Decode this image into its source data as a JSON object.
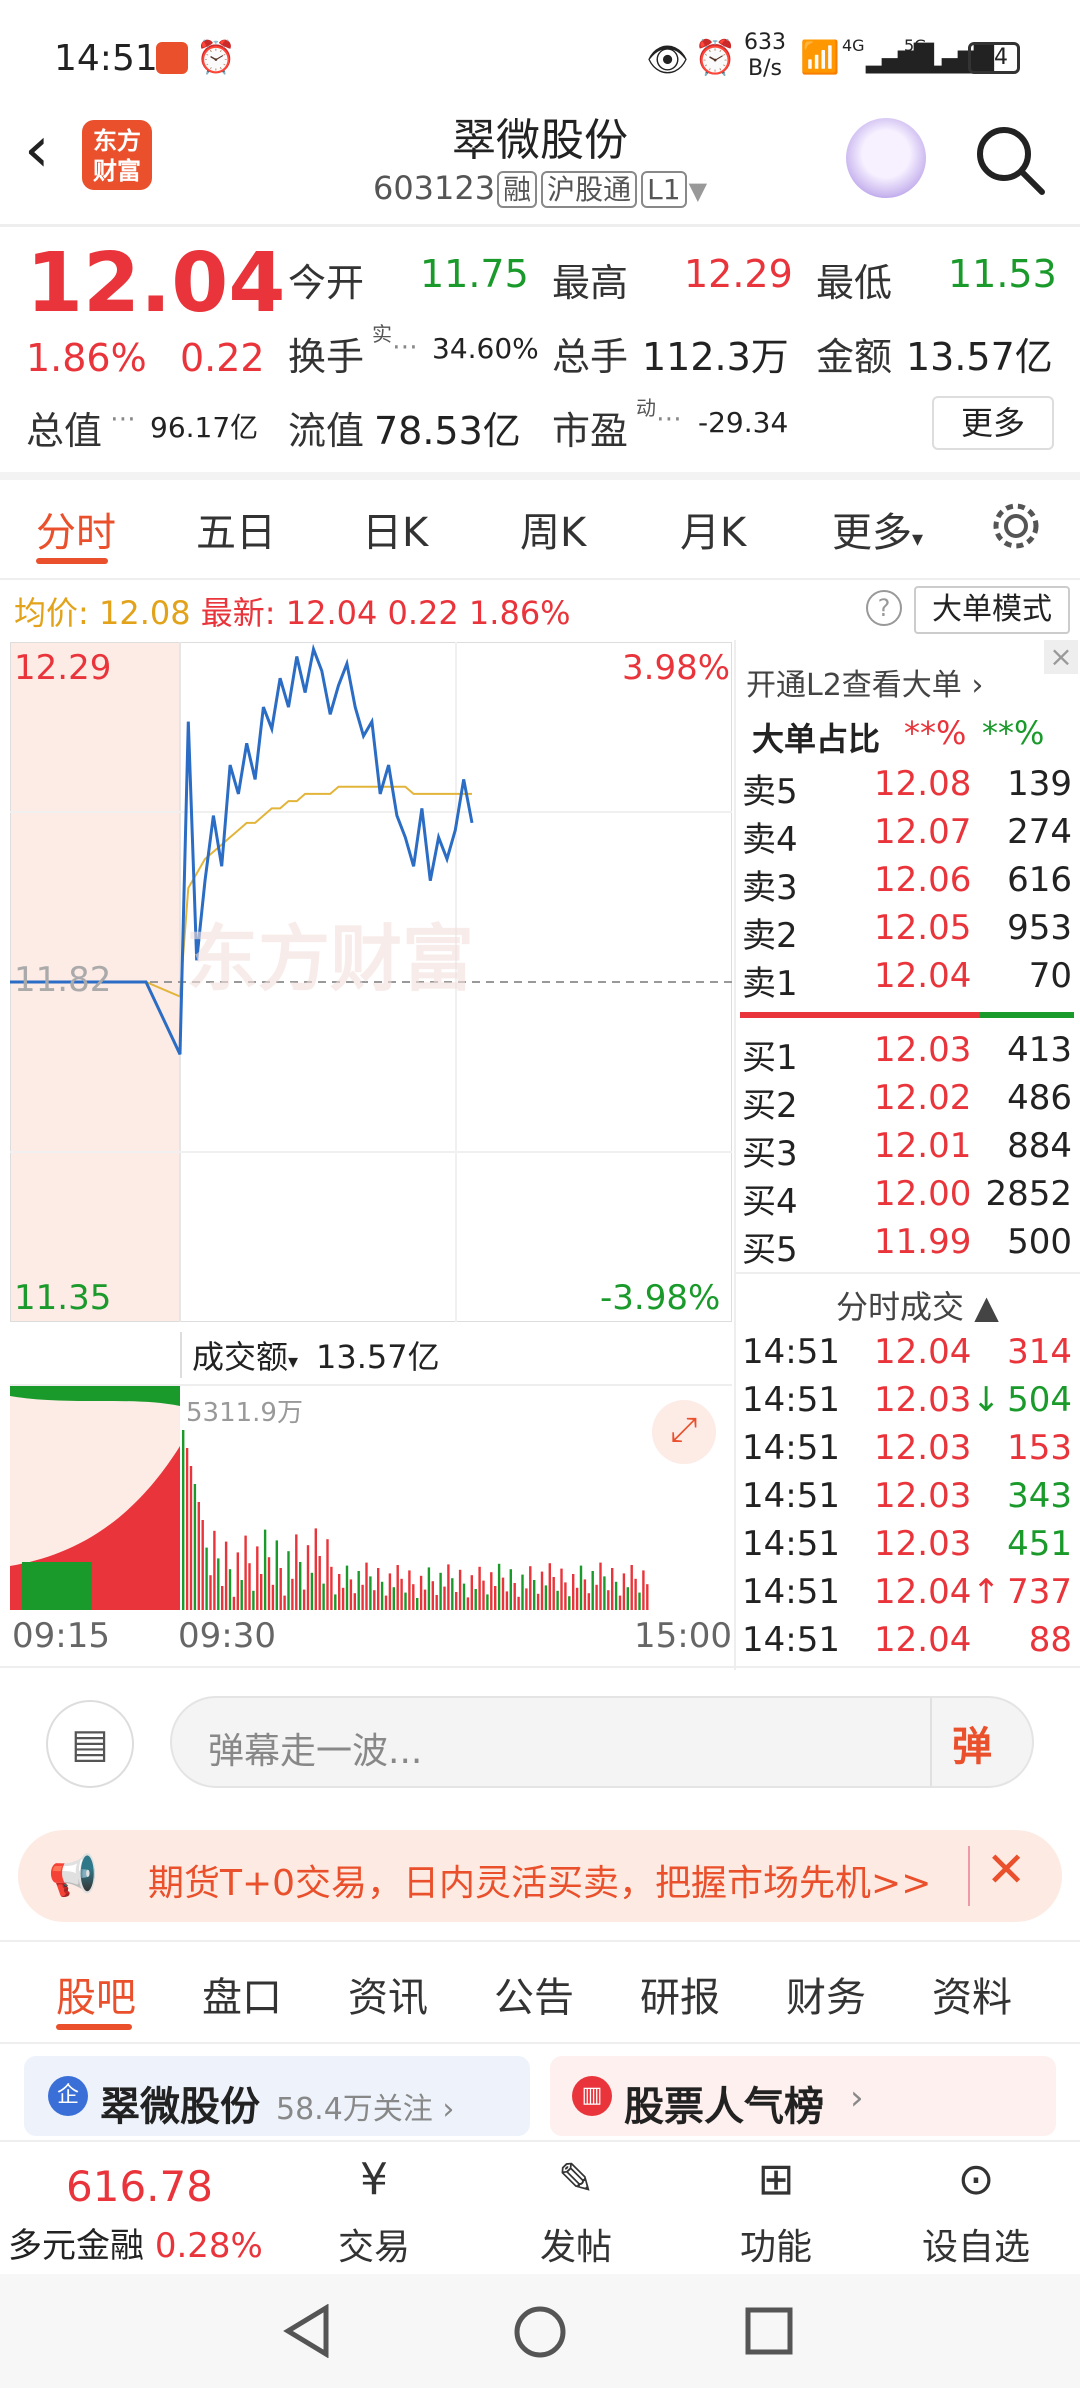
{
  "status": {
    "time": "14:51",
    "speed_top": "633",
    "speed_unit": "B/s",
    "network": "4G",
    "network2": "5G",
    "battery": "64"
  },
  "header": {
    "title": "翠微股份",
    "code": "603123",
    "tag1": "融",
    "tag2": "沪股通",
    "tag3": "L1",
    "logo_line1": "东方",
    "logo_line2": "财富"
  },
  "quote": {
    "price": "12.04",
    "pct": "1.86%",
    "chg": "0.22",
    "open_label": "今开",
    "open": "11.75",
    "high_label": "最高",
    "high": "12.29",
    "low_label": "最低",
    "low": "11.53",
    "turnover_label": "换手",
    "turnover_sup": "实",
    "turnover": "34.60%",
    "volume_label": "总手",
    "volume": "112.3万",
    "amount_label": "金额",
    "amount": "13.57亿",
    "mcap_label": "总值",
    "mcap": "96.17亿",
    "float_label": "流值",
    "float": "78.53亿",
    "pe_label": "市盈",
    "pe_sup": "动",
    "pe": "-29.34",
    "more_btn": "更多"
  },
  "chart_tabs": [
    "分时",
    "五日",
    "日K",
    "周K",
    "月K",
    "更多"
  ],
  "info_bar": {
    "avg_label": "均价:",
    "avg": "12.08",
    "latest_label": "最新:",
    "latest": "12.04",
    "chg": "0.22",
    "pct": "1.86%",
    "mode_btn": "大单模式"
  },
  "chart": {
    "y_high": "12.29",
    "y_mid": "11.82",
    "y_low": "11.35",
    "pct_high": "3.98%",
    "pct_low": "-3.98%",
    "watermark": "东方财富",
    "vol_label": "成交额",
    "vol_value": "13.57亿",
    "vol_max": "5311.9万",
    "t_start": "09:15",
    "t_open": "09:30",
    "t_end": "15:00"
  },
  "chart_data": {
    "type": "line",
    "series": [
      {
        "values": [
          11.82,
          11.82,
          11.82,
          11.82,
          11.82,
          11.72,
          12.18,
          11.85,
          11.96,
          12.05,
          11.98,
          12.12,
          12.08,
          12.15,
          12.1,
          12.2,
          12.17,
          12.24,
          12.2,
          12.27,
          12.22,
          12.28,
          12.25,
          12.19,
          12.23,
          12.26,
          12.2,
          12.16,
          12.18,
          12.08,
          12.12,
          12.05,
          12.02,
          11.98,
          12.06,
          11.96,
          12.02,
          11.99,
          12.03,
          12.1,
          12.04
        ]
      },
      {
        "values": [
          11.82,
          11.82,
          11.82,
          11.82,
          11.82,
          11.8,
          11.95,
          11.97,
          11.99,
          12.0,
          12.01,
          12.02,
          12.03,
          12.04,
          12.04,
          12.05,
          12.06,
          12.06,
          12.07,
          12.07,
          12.08,
          12.08,
          12.08,
          12.08,
          12.09,
          12.09,
          12.09,
          12.09,
          12.09,
          12.09,
          12.09,
          12.09,
          12.09,
          12.08,
          12.08,
          12.08,
          12.08,
          12.08,
          12.08,
          12.08,
          12.08
        ]
      }
    ],
    "ylim": [
      11.35,
      12.29
    ]
  },
  "panel": {
    "l2_link": "开通L2查看大单",
    "big_ratio_label": "大单占比",
    "big_ratio_buy": "**%",
    "big_ratio_sell": "**%",
    "sells": [
      {
        "l": "卖5",
        "p": "12.08",
        "v": "139"
      },
      {
        "l": "卖4",
        "p": "12.07",
        "v": "274"
      },
      {
        "l": "卖3",
        "p": "12.06",
        "v": "616"
      },
      {
        "l": "卖2",
        "p": "12.05",
        "v": "953"
      },
      {
        "l": "卖1",
        "p": "12.04",
        "v": "70"
      }
    ],
    "buys": [
      {
        "l": "买1",
        "p": "12.03",
        "v": "413"
      },
      {
        "l": "买2",
        "p": "12.02",
        "v": "486"
      },
      {
        "l": "买3",
        "p": "12.01",
        "v": "884"
      },
      {
        "l": "买4",
        "p": "12.00",
        "v": "2852"
      },
      {
        "l": "买5",
        "p": "11.99",
        "v": "500"
      }
    ],
    "ticks_title": "分时成交",
    "ticks": [
      {
        "t": "14:51",
        "p": "12.04",
        "v": "314",
        "a": ""
      },
      {
        "t": "14:51",
        "p": "12.03",
        "v": "504",
        "a": "↓"
      },
      {
        "t": "14:51",
        "p": "12.03",
        "v": "153",
        "a": ""
      },
      {
        "t": "14:51",
        "p": "12.03",
        "v": "343",
        "a": ""
      },
      {
        "t": "14:51",
        "p": "12.03",
        "v": "451",
        "a": ""
      },
      {
        "t": "14:51",
        "p": "12.04",
        "v": "737",
        "a": "↑"
      },
      {
        "t": "14:51",
        "p": "12.04",
        "v": "88",
        "a": ""
      }
    ]
  },
  "danmu": {
    "placeholder": "弹幕走一波...",
    "btn": "弹"
  },
  "ad": {
    "text": "期货T+0交易，日内灵活买卖，把握市场先机>>"
  },
  "bottom_tabs": [
    "股吧",
    "盘口",
    "资讯",
    "公告",
    "研报",
    "财务",
    "资料"
  ],
  "cards": {
    "c1_title": "翠微股份",
    "c1_sub": "58.4万关注",
    "c2_title": "股票人气榜"
  },
  "nav": {
    "index_value": "616.78",
    "index_name": "多元金融",
    "index_pct": "0.28%",
    "items": [
      "交易",
      "发帖",
      "功能",
      "设自选"
    ]
  }
}
